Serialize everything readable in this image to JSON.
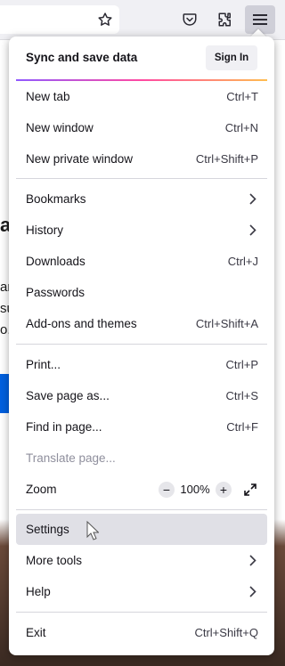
{
  "toolbar": {
    "icons": [
      "bookmark-star-icon",
      "pocket-icon",
      "extensions-icon",
      "hamburger-menu-icon"
    ]
  },
  "background_fragments": [
    "al",
    "ar",
    "su",
    "o."
  ],
  "menu": {
    "sync": {
      "title": "Sync and save data",
      "button": "Sign In"
    },
    "groups": [
      [
        {
          "label": "New tab",
          "shortcut": "Ctrl+T"
        },
        {
          "label": "New window",
          "shortcut": "Ctrl+N"
        },
        {
          "label": "New private window",
          "shortcut": "Ctrl+Shift+P"
        }
      ],
      [
        {
          "label": "Bookmarks",
          "shortcut": "",
          "submenu": true
        },
        {
          "label": "History",
          "shortcut": "",
          "submenu": true
        },
        {
          "label": "Downloads",
          "shortcut": "Ctrl+J"
        },
        {
          "label": "Passwords",
          "shortcut": ""
        },
        {
          "label": "Add-ons and themes",
          "shortcut": "Ctrl+Shift+A"
        }
      ],
      [
        {
          "label": "Print...",
          "shortcut": "Ctrl+P"
        },
        {
          "label": "Save page as...",
          "shortcut": "Ctrl+S"
        },
        {
          "label": "Find in page...",
          "shortcut": "Ctrl+F"
        },
        {
          "label": "Translate page...",
          "shortcut": "",
          "disabled": true
        },
        {
          "label": "Zoom",
          "zoom": {
            "minus": "−",
            "level": "100%",
            "plus": "+"
          }
        }
      ],
      [
        {
          "label": "Settings",
          "shortcut": "",
          "hover": true
        },
        {
          "label": "More tools",
          "shortcut": "",
          "submenu": true
        },
        {
          "label": "Help",
          "shortcut": "",
          "submenu": true
        }
      ],
      [
        {
          "label": "Exit",
          "shortcut": "Ctrl+Shift+Q"
        }
      ]
    ]
  }
}
